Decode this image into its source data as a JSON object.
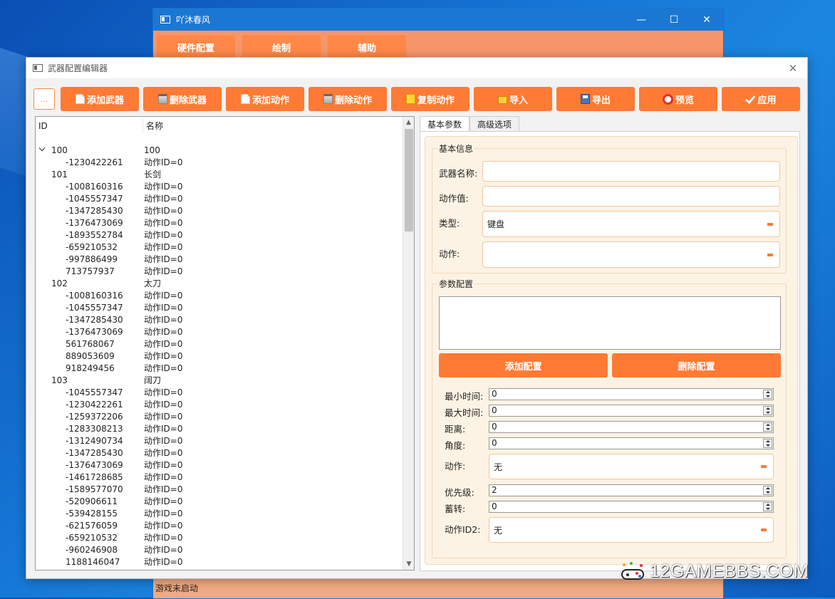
{
  "back_window": {
    "title": "吖沐春风",
    "controls": {
      "minimize": "—",
      "maximize": "☐",
      "close": "✕"
    },
    "tabs": [
      "硬件配置",
      "绘制",
      "辅助"
    ],
    "status": "游戏未启动"
  },
  "editor": {
    "title": "武器配置编辑器",
    "close_glyph": "✕",
    "more_label": "...",
    "toolbar": [
      {
        "label": "添加武器",
        "icon": "doc-icon"
      },
      {
        "label": "删除武器",
        "icon": "trash-icon"
      },
      {
        "label": "添加动作",
        "icon": "doc-icon"
      },
      {
        "label": "删除动作",
        "icon": "trash-icon"
      },
      {
        "label": "复制动作",
        "icon": "copy-icon"
      },
      {
        "label": "导入",
        "icon": "folder-icon"
      },
      {
        "label": "导出",
        "icon": "save-icon"
      },
      {
        "label": "预览",
        "icon": "lifebuoy-icon"
      },
      {
        "label": "应用",
        "icon": "check-icon"
      }
    ],
    "tree": {
      "columns": [
        "ID",
        "名称"
      ],
      "rows": [
        {
          "type": "parent",
          "id": "100",
          "name": "100"
        },
        {
          "type": "child",
          "id": "-1230422261",
          "name": "动作ID=0"
        },
        {
          "type": "parent",
          "id": "101",
          "name": "长剑"
        },
        {
          "type": "child",
          "id": "-1008160316",
          "name": "动作ID=0"
        },
        {
          "type": "child",
          "id": "-1045557347",
          "name": "动作ID=0"
        },
        {
          "type": "child",
          "id": "-1347285430",
          "name": "动作ID=0"
        },
        {
          "type": "child",
          "id": "-1376473069",
          "name": "动作ID=0"
        },
        {
          "type": "child",
          "id": "-1893552784",
          "name": "动作ID=0"
        },
        {
          "type": "child",
          "id": "-659210532",
          "name": "动作ID=0"
        },
        {
          "type": "child",
          "id": "-997886499",
          "name": "动作ID=0"
        },
        {
          "type": "child",
          "id": "713757937",
          "name": "动作ID=0"
        },
        {
          "type": "parent",
          "id": "102",
          "name": "太刀"
        },
        {
          "type": "child",
          "id": "-1008160316",
          "name": "动作ID=0"
        },
        {
          "type": "child",
          "id": "-1045557347",
          "name": "动作ID=0"
        },
        {
          "type": "child",
          "id": "-1347285430",
          "name": "动作ID=0"
        },
        {
          "type": "child",
          "id": "-1376473069",
          "name": "动作ID=0"
        },
        {
          "type": "child",
          "id": "561768067",
          "name": "动作ID=0"
        },
        {
          "type": "child",
          "id": "889053609",
          "name": "动作ID=0"
        },
        {
          "type": "child",
          "id": "918249456",
          "name": "动作ID=0"
        },
        {
          "type": "parent",
          "id": "103",
          "name": "阔刀"
        },
        {
          "type": "child",
          "id": "-1045557347",
          "name": "动作ID=0"
        },
        {
          "type": "child",
          "id": "-1230422261",
          "name": "动作ID=0"
        },
        {
          "type": "child",
          "id": "-1259372206",
          "name": "动作ID=0"
        },
        {
          "type": "child",
          "id": "-1283308213",
          "name": "动作ID=0"
        },
        {
          "type": "child",
          "id": "-1312490734",
          "name": "动作ID=0"
        },
        {
          "type": "child",
          "id": "-1347285430",
          "name": "动作ID=0"
        },
        {
          "type": "child",
          "id": "-1376473069",
          "name": "动作ID=0"
        },
        {
          "type": "child",
          "id": "-1461728685",
          "name": "动作ID=0"
        },
        {
          "type": "child",
          "id": "-1589577070",
          "name": "动作ID=0"
        },
        {
          "type": "child",
          "id": "-520906611",
          "name": "动作ID=0"
        },
        {
          "type": "child",
          "id": "-539428155",
          "name": "动作ID=0"
        },
        {
          "type": "child",
          "id": "-621576059",
          "name": "动作ID=0"
        },
        {
          "type": "child",
          "id": "-659210532",
          "name": "动作ID=0"
        },
        {
          "type": "child",
          "id": "-960246908",
          "name": "动作ID=0"
        },
        {
          "type": "child",
          "id": "1188146047",
          "name": "动作ID=0"
        }
      ]
    },
    "tabs": [
      "基本参数",
      "高级选项"
    ],
    "basic_info": {
      "title": "基本信息",
      "weapon_name_label": "武器名称:",
      "action_value_label": "动作值:",
      "type_label": "类型:",
      "type_value": "键盘",
      "action_label": "动作:"
    },
    "param_config": {
      "title": "参数配置",
      "add_label": "添加配置",
      "delete_label": "删除配置",
      "min_time_label": "最小时间:",
      "min_time_value": "0",
      "max_time_label": "最大时间:",
      "max_time_value": "0",
      "distance_label": "距离:",
      "distance_value": "0",
      "angle_label": "角度:",
      "angle_value": "0",
      "action_label": "动作:",
      "action_value": "无",
      "priority_label": "优先级:",
      "priority_value": "2",
      "charge_label": "蓄转:",
      "charge_value": "0",
      "action2_label": "动作ID2:",
      "action2_value": "无"
    }
  },
  "watermark": "12GAMEBBS.COM",
  "colors": {
    "accent": "#ff7a34",
    "desktop": "#1677d6",
    "titlebar": "#1b78d2"
  }
}
